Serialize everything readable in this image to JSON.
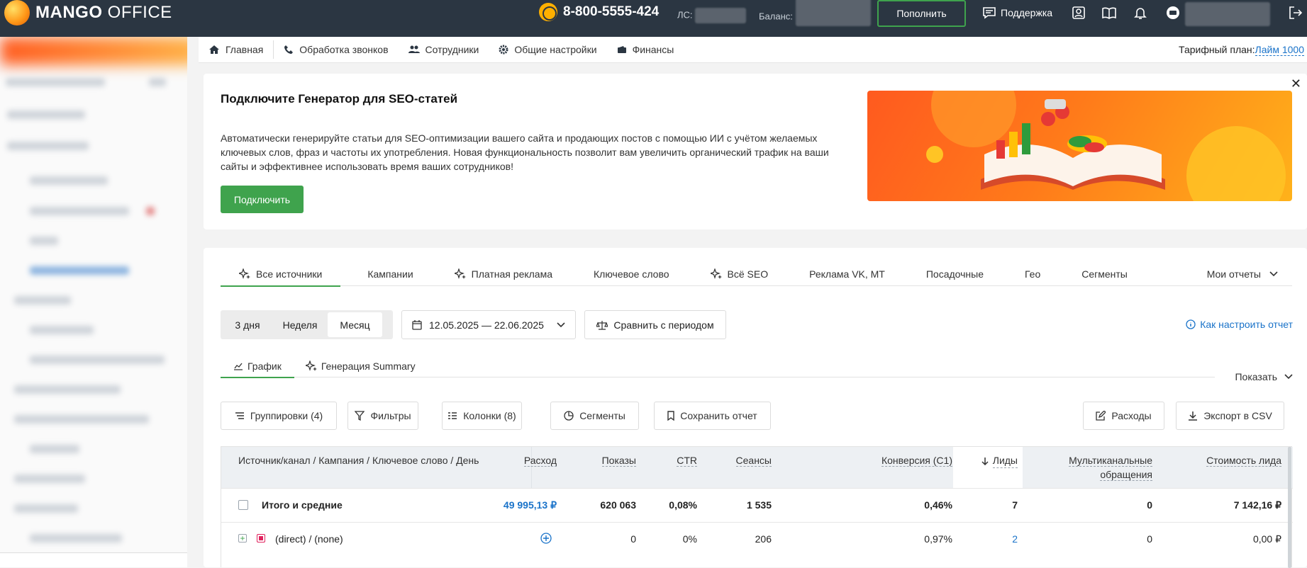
{
  "topbar": {
    "logo_bold": "MANGO",
    "logo_light": " OFFICE",
    "phone": "8-800-5555-424",
    "ls_label": "ЛС:",
    "balance_label": "Баланс:",
    "topup_label": "Пополнить",
    "support_label": "Поддержка"
  },
  "nav": {
    "items": [
      {
        "label": "Главная",
        "icon": "home-icon"
      },
      {
        "label": "Обработка звонков",
        "icon": "phone-icon"
      },
      {
        "label": "Сотрудники",
        "icon": "users-icon"
      },
      {
        "label": "Общие настройки",
        "icon": "gear-icon"
      },
      {
        "label": "Финансы",
        "icon": "wallet-icon"
      }
    ],
    "tariff_label": "Тарифный план:",
    "tariff_value": "Лайм 1000"
  },
  "promo": {
    "title": "Подключите Генератор для SEO-статей",
    "text": "Автоматически генерируйте статьи для SEO-оптимизации вашего сайта и продающих постов с помощью ИИ с учётом желаемых ключевых слов, фраз и частоты их употребления. Новая функциональность позволит вам увеличить органический трафик на ваши сайты и эффективнее использовать время ваших сотрудников!",
    "button": "Подключить",
    "close": "✕"
  },
  "report": {
    "tabs": [
      "Все источники",
      "Кампании",
      "Платная реклама",
      "Ключевое слово",
      "Всё SEO",
      "Реклама VK, MT",
      "Посадочные",
      "Гео",
      "Сегменты"
    ],
    "my_reports": "Мои отчеты",
    "periods": [
      "3 дня",
      "Неделя",
      "Месяц"
    ],
    "date_range": "12.05.2025 — 22.06.2025",
    "compare": "Сравнить с периодом",
    "howto": "Как настроить отчет",
    "subtabs": [
      "График",
      "Генерация Summary"
    ],
    "show": "Показать",
    "buttons": {
      "groupings": "Группировки (4)",
      "filters": "Фильтры",
      "columns": "Колонки (8)",
      "segments": "Сегменты",
      "save": "Сохранить отчет",
      "expenses": "Расходы",
      "export": "Экспорт в CSV"
    },
    "table": {
      "headers": [
        "Источник/канал / Кампания / Ключевое слово / День",
        "Расход",
        "Показы",
        "CTR",
        "Сеансы",
        "Конверсия (C1)",
        "Лиды",
        "Мультиканальные",
        "обращения",
        "Стоимость лида"
      ],
      "total": {
        "label": "Итого и средние",
        "spend": "49 995,13 ₽",
        "shows": "620 063",
        "ctr": "0,08%",
        "sessions": "1 535",
        "conv": "0,46%",
        "leads": "7",
        "multi": "0",
        "cost": "7 142,16 ₽"
      },
      "row": {
        "label": "(direct) / (none)",
        "shows": "0",
        "ctr": "0%",
        "sessions": "206",
        "conv": "0,97%",
        "leads": "2",
        "multi": "0",
        "cost": "0,00 ₽"
      }
    }
  }
}
